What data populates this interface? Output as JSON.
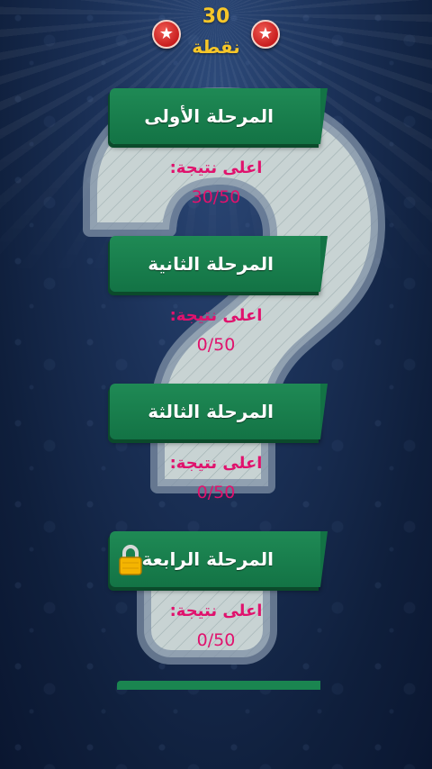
{
  "header": {
    "points_value": "30",
    "points_label": "نقطة",
    "star_symbol": "★"
  },
  "levels": [
    {
      "label": "المرحلة الأولى",
      "best_label": "اعلى نتيجة:",
      "best_score": "30/50",
      "locked": false
    },
    {
      "label": "المرحلة الثانية",
      "best_label": "اعلى نتيجة:",
      "best_score": "0/50",
      "locked": false
    },
    {
      "label": "المرحلة الثالثة",
      "best_label": "اعلى نتيجة:",
      "best_score": "0/50",
      "locked": false
    },
    {
      "label": "المرحلة الرابعة",
      "best_label": "اعلى نتيجة:",
      "best_score": "0/50",
      "locked": true
    }
  ],
  "colors": {
    "gold": "#f6c629",
    "button_green": "#1a8550",
    "score_pink": "#e0126d",
    "background_navy": "#142a4e"
  },
  "icons": [
    "star-icon",
    "lock-icon",
    "question-mark-graphic"
  ]
}
